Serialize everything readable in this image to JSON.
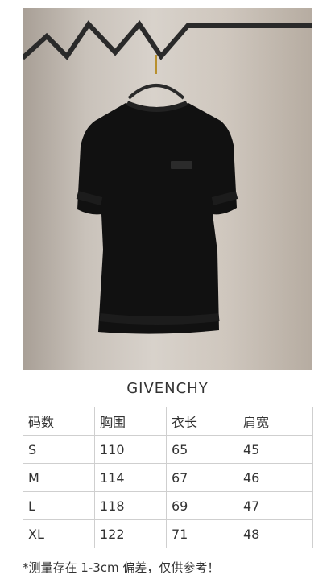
{
  "brand": "GIVENCHY",
  "table": {
    "headers": [
      "码数",
      "胸围",
      "衣长",
      "肩宽"
    ],
    "rows": [
      [
        "S",
        "110",
        "65",
        "45"
      ],
      [
        "M",
        "114",
        "67",
        "46"
      ],
      [
        "L",
        "118",
        "69",
        "47"
      ],
      [
        "XL",
        "122",
        "71",
        "48"
      ]
    ]
  },
  "note": "*测量存在 1-3cm 偏差，仅供参考！",
  "colors": {
    "shirt": "#111111",
    "background": "#ffffff",
    "wall": "#cfc7be"
  }
}
